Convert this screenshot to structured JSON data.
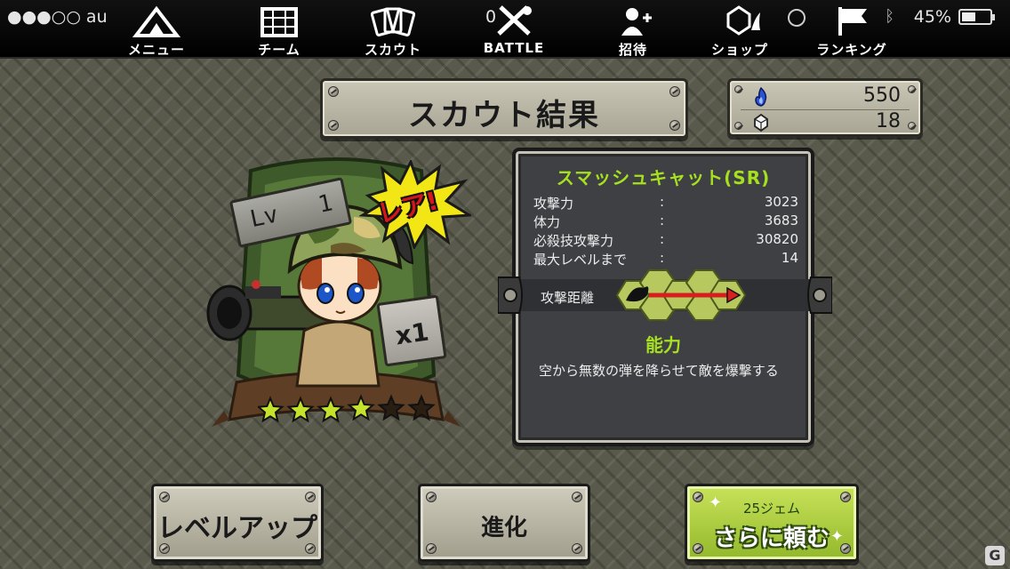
{
  "status_bar": {
    "carrier": "●●●○○ au",
    "time": "0",
    "battery": "45%"
  },
  "nav": {
    "items": [
      {
        "label": "メニュー",
        "icon": "tent-menu-icon"
      },
      {
        "label": "チーム",
        "icon": "map-team-icon"
      },
      {
        "label": "スカウト",
        "icon": "cards-scout-icon"
      },
      {
        "label": "BATTLE",
        "icon": "crossed-swords-battle-icon"
      },
      {
        "label": "招待",
        "icon": "invite-person-icon"
      },
      {
        "label": "ショップ",
        "icon": "gem-shop-icon"
      },
      {
        "label": "ランキング",
        "icon": "flag-ranking-icon"
      }
    ]
  },
  "header": {
    "title": "スカウト結果"
  },
  "currency": {
    "flame_value": "550",
    "gem_value": "18",
    "flame_icon": "blue-flame-icon",
    "gem_icon": "gem-icon"
  },
  "card": {
    "level_label": "Lv",
    "level_value": "1",
    "rarity_badge": "レア!",
    "count": "x1",
    "stars_total": 6,
    "stars_filled": 4,
    "colors": {
      "frame": "#3e5a2a",
      "star_active": "#c6e32c",
      "rare_burst": "#f2e614"
    }
  },
  "info": {
    "name": "スマッシュキャット(SR)",
    "stats": [
      {
        "label": "攻撃力",
        "colon": ":",
        "value": "3023"
      },
      {
        "label": "体力",
        "colon": ":",
        "value": "3683"
      },
      {
        "label": "必殺技攻撃力",
        "colon": ":",
        "value": "30820"
      },
      {
        "label": "最大レベルまで",
        "colon": ":",
        "value": "14"
      }
    ],
    "range_label": "攻撃距離",
    "ability_title": "能力",
    "ability_desc": "空から無数の弾を降らせて敵を爆撃する",
    "colors": {
      "accent": "#a6e01f",
      "panel": "#3f4044",
      "arrow": "#d81e1e"
    }
  },
  "buttons": {
    "level_up": "レベルアップ",
    "evolve": "進化",
    "scout_again_cost": "25ジェム",
    "scout_again": "さらに頼む"
  },
  "watermark": "G"
}
